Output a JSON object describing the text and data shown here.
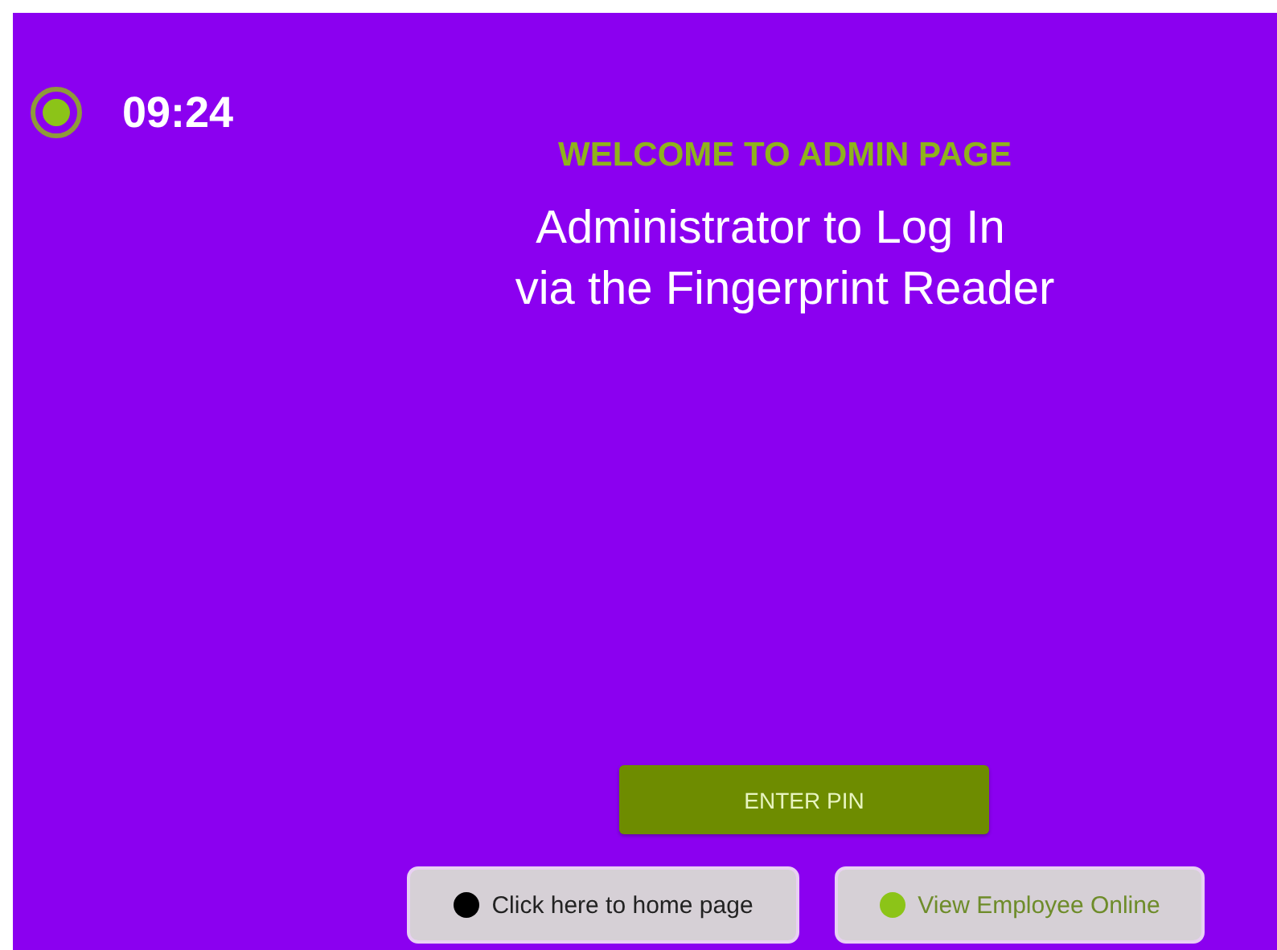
{
  "clock": {
    "time": "09:24"
  },
  "welcome": {
    "title": "WELCOME TO ADMIN PAGE",
    "message_lines": [
      "Administrator to Log In",
      "via the Fingerprint Reader"
    ]
  },
  "primary_button": {
    "label": "ENTER PIN"
  },
  "buttons": [
    {
      "label": "Click here to home page",
      "color": "#000000",
      "kind": "dark"
    },
    {
      "label": "View Employee Online",
      "color": "#8cc418",
      "kind": "green"
    }
  ]
}
